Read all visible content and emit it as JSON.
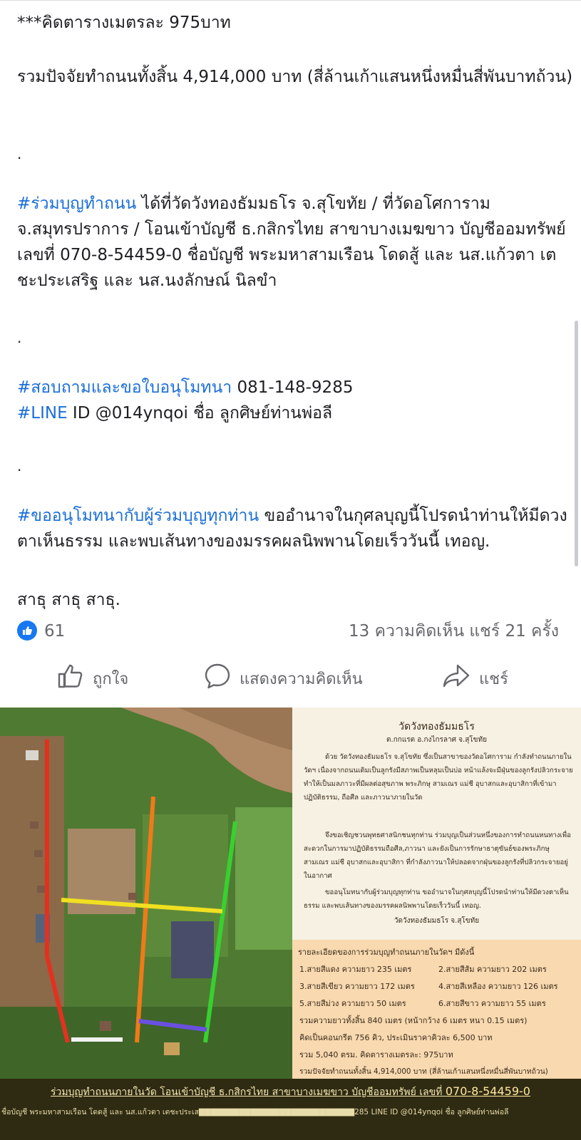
{
  "post": {
    "line_cost_per_meter": "***คิดตารางเมตรละ 975บาท",
    "total": "รวมปัจจัยทำถนนทั้งสิ้น 4,914,000 บาท (สี่ล้านเก้าแสนหนึ่งหมื่นสี่พันบาทถ้วน)",
    "dot": ".",
    "donate_tag": "#ร่วมบุญทำถนน",
    "donate_text": " ได้ที่วัดวังทองธัมมธโร จ.สุโขทัย / ที่วัดอโศการาม จ.สมุทรปราการ /  โอนเข้าบัญชี ธ.กสิกรไทย สาขาบางเมฆขาว บัญชีออมทรัพย์ เลขที่ 070-8-54459-0 ชื่อบัญชี พระมหาสามเรือน โดดสู้ และ นส.แก้วตา เตชะประเสริฐ และ นส.นงลักษณ์ นิลขำ",
    "inquiry_tag": "#สอบถามและขอใบอนุโมทนา",
    "inquiry_phone": " 081-148-9285",
    "line_tag": "#LINE",
    "line_text": " ID @014ynqoi ชื่อ ลูกศิษย์ท่านพ่อลี",
    "anumodana_tag": "#ขออนุโมทนากับผู้ร่วมบุญทุกท่าน",
    "anumodana_text": " ขออำนาจในกุศลบุญนี้โปรดนำท่านให้มีดวงตาเห็นธรรม และพบเส้นทางของมรรคผลนิพพานโดยเร็ววันนี้ เทอญ.",
    "sadhu": "สาธุ สาธุ สาธุ."
  },
  "stats": {
    "likes": "61",
    "comments_shares": "13 ความคิดเห็น  แชร์ 21 ครั้ง"
  },
  "actions": {
    "like": "ถูกใจ",
    "comment": "แสดงความคิดเห็น",
    "share": "แชร์"
  },
  "colors": {
    "hashtag": "#1a6ed8",
    "like_blue": "#1877f2",
    "muted": "#65676b"
  },
  "image": {
    "notice_title": "วัดวังทองธัมมธโร",
    "notice_sub": "ต.กกแรต อ.กงไกรลาศ จ.สุโขทัย",
    "notice_p1": "ด้วย วัดวังทองธัมมธโร จ.สุโขทัย ซึ่งเป็นสาขาของวัดอโศการาม กำลังทำถนนภายในวัดฯ เนื่องจากถนนเดิมเป็นลูกรังมีสภาพเป็นหลุมเป็นบ่อ หน้าแล้งจะมีฝุ่นของลูกรังปลิวกระจาย ทำให้เป็นมลภาวะที่มีผลต่อสุขภาพ พระภิกษุ สามเณร แม่ชี อุบาสกและอุบาสิกาที่เข้ามาปฏิบัติธรรม, ถือศีล และภาวนาภายในวัด",
    "notice_p2": "จึงขอเชิญชวนพุทธศาสนิกชนทุกท่าน ร่วมบุญเป็นส่วนหนึ่งของการทำถนนหนทางเพื่อสะดวกในการมาปฏิบัติธรรมถือศีล,ภาวนา และยังเป็นการรักษาธาตุขันธ์ของพระภิกษุ สามเณร แม่ชี อุบาสกและอุบาสิกา ที่กำลังภาวนาให้ปลอดจากฝุ่นของลูกรังที่ปลิวกระจายอยู่ในอากาศ",
    "notice_p3": "ขออนุโมทนากับผู้ร่วมบุญทุกท่าน ขออำนาจในกุศลบุญนี้โปรดนำท่านให้มีดวงตาเห็นธรรม และพบเส้นทางของมรรคผลนิพพานโดยเร็ววันนี้ เทอญ.",
    "notice_sign": "วัดวังทองธัมมธโร จ.สุโขทัย",
    "detail_head": "รายละเอียดของการร่วมบุญทำถนนภายในวัดฯ มีดังนี้",
    "red": "1.สายสีแดง ความยาว 235 เมตร",
    "orange": "2.สายสีส้ม ความยาว 202 เมตร",
    "green": "3.สายสีเขียว ความยาว 172 เมตร",
    "yellow": "4.สายสีเหลือง ความยาว 126 เมตร",
    "purple": "5.สายสีม่วง ความยาว 50 เมตร",
    "white": "6.สายสีขาว ความยาว 55 เมตร",
    "total_length": "รวมความยาวทั้งสิ้น 840 เมตร (หน้ากว้าง 6 เมตร หนา 0.15 เมตร)",
    "concrete": "คิดเป็นคอนกรีต  756 คิว,  ประเมินราคาคิวละ  6,500 บาท",
    "area": "รวม 5,040 ตรม. คิดตารางเมตรละ: 975บาท",
    "grand_total": "รวมปัจจัยทำถนนทั้งสิ้น 4,914,000 บาท (สี่ล้านเก้าแสนหนึ่งหมื่นสี่พันบาทถ้วน)",
    "banner_a": "ร่วมบุญทำถนนภายในวัด โอนเข้าบัญชี ธ.กสิกรไทย สาขาบางเมฆขาว บัญชีออมทรัพย์ เลขที่ ",
    "banner_account": "070-8-54459-0",
    "banner_b": "ชื่อบัญชี พระมหาสามเรือน โดดสู้ และ นส.แก้วตา เตชะประเส▇▇▇▇▇▇▇▇▇▇▇▇▇▇▇▇▇▇▇▇▇▇▇▇▇▇▇285 LINE ID @014ynqoi ชื่อ ลูกศิษย์ท่านพ่อลี"
  }
}
